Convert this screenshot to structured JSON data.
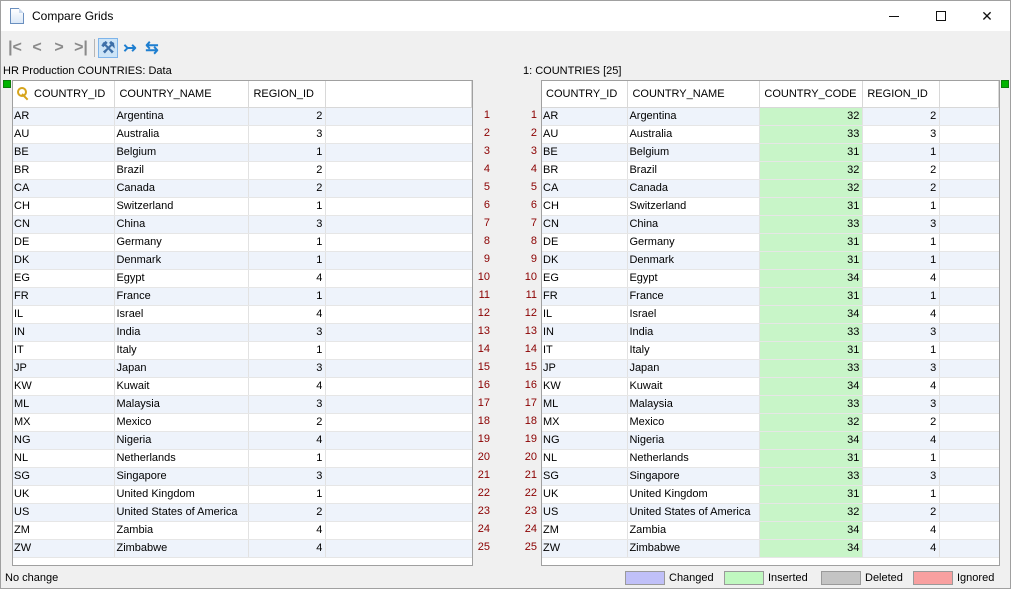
{
  "window": {
    "title": "Compare Grids",
    "icon": "document-icon"
  },
  "toolbar": {
    "buttons": [
      {
        "name": "first-diff",
        "glyph": "|<"
      },
      {
        "name": "prev-diff",
        "glyph": "<"
      },
      {
        "name": "next-diff",
        "glyph": ">"
      },
      {
        "name": "last-diff",
        "glyph": ">|"
      },
      {
        "name": "options",
        "glyph": "⚒"
      },
      {
        "name": "auto-scroll",
        "glyph": "↣"
      },
      {
        "name": "refresh",
        "glyph": "⇆"
      }
    ]
  },
  "left": {
    "caption": "HR Production COUNTRIES: Data",
    "columns": [
      "COUNTRY_ID",
      "COUNTRY_NAME",
      "REGION_ID"
    ],
    "rows": [
      [
        "AR",
        "Argentina",
        "2"
      ],
      [
        "AU",
        "Australia",
        "3"
      ],
      [
        "BE",
        "Belgium",
        "1"
      ],
      [
        "BR",
        "Brazil",
        "2"
      ],
      [
        "CA",
        "Canada",
        "2"
      ],
      [
        "CH",
        "Switzerland",
        "1"
      ],
      [
        "CN",
        "China",
        "3"
      ],
      [
        "DE",
        "Germany",
        "1"
      ],
      [
        "DK",
        "Denmark",
        "1"
      ],
      [
        "EG",
        "Egypt",
        "4"
      ],
      [
        "FR",
        "France",
        "1"
      ],
      [
        "IL",
        "Israel",
        "4"
      ],
      [
        "IN",
        "India",
        "3"
      ],
      [
        "IT",
        "Italy",
        "1"
      ],
      [
        "JP",
        "Japan",
        "3"
      ],
      [
        "KW",
        "Kuwait",
        "4"
      ],
      [
        "ML",
        "Malaysia",
        "3"
      ],
      [
        "MX",
        "Mexico",
        "2"
      ],
      [
        "NG",
        "Nigeria",
        "4"
      ],
      [
        "NL",
        "Netherlands",
        "1"
      ],
      [
        "SG",
        "Singapore",
        "3"
      ],
      [
        "UK",
        "United Kingdom",
        "1"
      ],
      [
        "US",
        "United States of America",
        "2"
      ],
      [
        "ZM",
        "Zambia",
        "4"
      ],
      [
        "ZW",
        "Zimbabwe",
        "4"
      ]
    ]
  },
  "right": {
    "caption": "1: COUNTRIES [25]",
    "columns": [
      "COUNTRY_ID",
      "COUNTRY_NAME",
      "COUNTRY_CODE",
      "REGION_ID"
    ],
    "rows": [
      [
        "AR",
        "Argentina",
        "32",
        "2"
      ],
      [
        "AU",
        "Australia",
        "33",
        "3"
      ],
      [
        "BE",
        "Belgium",
        "31",
        "1"
      ],
      [
        "BR",
        "Brazil",
        "32",
        "2"
      ],
      [
        "CA",
        "Canada",
        "32",
        "2"
      ],
      [
        "CH",
        "Switzerland",
        "31",
        "1"
      ],
      [
        "CN",
        "China",
        "33",
        "3"
      ],
      [
        "DE",
        "Germany",
        "31",
        "1"
      ],
      [
        "DK",
        "Denmark",
        "31",
        "1"
      ],
      [
        "EG",
        "Egypt",
        "34",
        "4"
      ],
      [
        "FR",
        "France",
        "31",
        "1"
      ],
      [
        "IL",
        "Israel",
        "34",
        "4"
      ],
      [
        "IN",
        "India",
        "33",
        "3"
      ],
      [
        "IT",
        "Italy",
        "31",
        "1"
      ],
      [
        "JP",
        "Japan",
        "33",
        "3"
      ],
      [
        "KW",
        "Kuwait",
        "34",
        "4"
      ],
      [
        "ML",
        "Malaysia",
        "33",
        "3"
      ],
      [
        "MX",
        "Mexico",
        "32",
        "2"
      ],
      [
        "NG",
        "Nigeria",
        "34",
        "4"
      ],
      [
        "NL",
        "Netherlands",
        "31",
        "1"
      ],
      [
        "SG",
        "Singapore",
        "33",
        "3"
      ],
      [
        "UK",
        "United Kingdom",
        "31",
        "1"
      ],
      [
        "US",
        "United States of America",
        "32",
        "2"
      ],
      [
        "ZM",
        "Zambia",
        "34",
        "4"
      ],
      [
        "ZW",
        "Zimbabwe",
        "34",
        "4"
      ]
    ]
  },
  "line_numbers": [
    "1",
    "2",
    "3",
    "4",
    "5",
    "6",
    "7",
    "8",
    "9",
    "10",
    "11",
    "12",
    "13",
    "14",
    "15",
    "16",
    "17",
    "18",
    "19",
    "20",
    "21",
    "22",
    "23",
    "24",
    "25"
  ],
  "status": {
    "text": "No change",
    "legend": [
      {
        "label": "Changed",
        "color": "#c0c0f8"
      },
      {
        "label": "Inserted",
        "color": "#c0f8c0"
      },
      {
        "label": "Deleted",
        "color": "#c4c4c4"
      },
      {
        "label": "Ignored",
        "color": "#f8a0a0"
      }
    ]
  },
  "colors": {
    "inserted_cell": "#c8f5c8",
    "marker": "#00b400",
    "line_number": "#8b0000"
  }
}
